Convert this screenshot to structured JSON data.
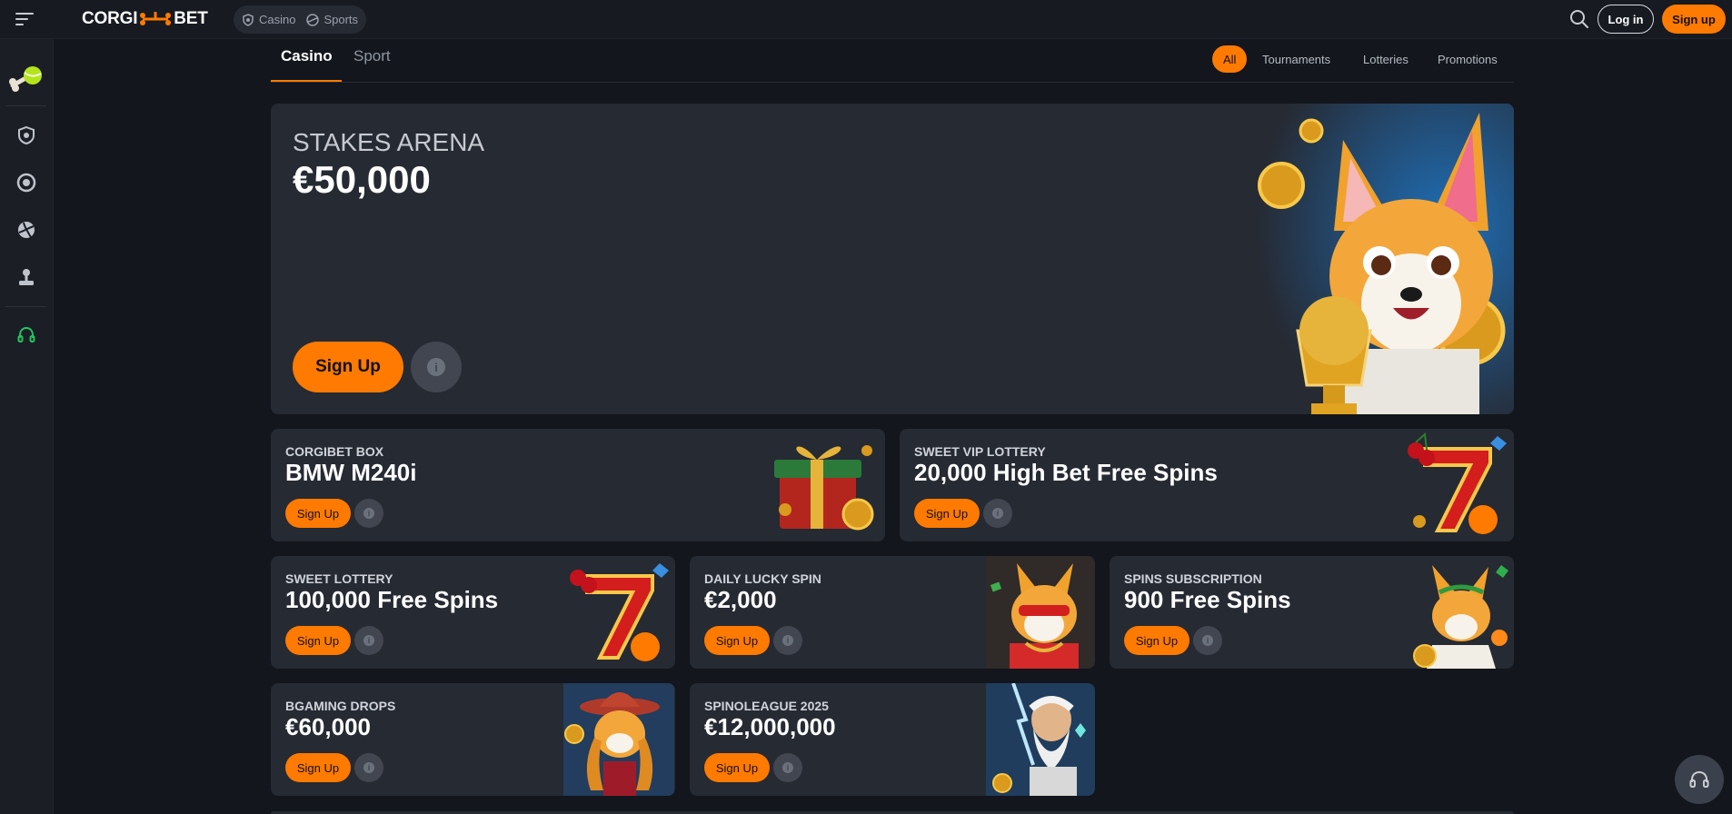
{
  "header": {
    "logo_left": "CORGI",
    "logo_right": "BET",
    "nav": [
      {
        "label": "Casino",
        "icon": "casino-shield-icon"
      },
      {
        "label": "Sports",
        "icon": "ball-icon"
      }
    ],
    "login_label": "Log in",
    "signup_label": "Sign up"
  },
  "tabs": {
    "main": [
      "Casino",
      "Sport"
    ],
    "filters": [
      "All",
      "Tournaments",
      "Lotteries",
      "Promotions"
    ]
  },
  "hero": {
    "subtitle": "STAKES ARENA",
    "title": "€50,000",
    "signup_label": "Sign Up",
    "info_glyph": "i"
  },
  "promos": [
    {
      "subtitle": "CORGIBET BOX",
      "title": "BMW M240i",
      "signup_label": "Sign Up",
      "info_glyph": "i"
    },
    {
      "subtitle": "SWEET VIP LOTTERY",
      "title": "20,000 High Bet Free Spins",
      "signup_label": "Sign Up",
      "info_glyph": "i"
    },
    {
      "subtitle": "SWEET LOTTERY",
      "title": "100,000 Free Spins",
      "signup_label": "Sign Up",
      "info_glyph": "i"
    },
    {
      "subtitle": "DAILY LUCKY SPIN",
      "title": "€2,000",
      "signup_label": "Sign Up",
      "info_glyph": "i"
    },
    {
      "subtitle": "SPINS SUBSCRIPTION",
      "title": "900 Free Spins",
      "signup_label": "Sign Up",
      "info_glyph": "i"
    },
    {
      "subtitle": "BGAMING DROPS",
      "title": "€60,000",
      "signup_label": "Sign Up",
      "info_glyph": "i"
    },
    {
      "subtitle": "SPINOLEAGUE 2025",
      "title": "€12,000,000",
      "signup_label": "Sign Up",
      "info_glyph": "i"
    }
  ],
  "colors": {
    "accent": "#ff7a00",
    "card": "#262a33",
    "background": "#13161c"
  }
}
